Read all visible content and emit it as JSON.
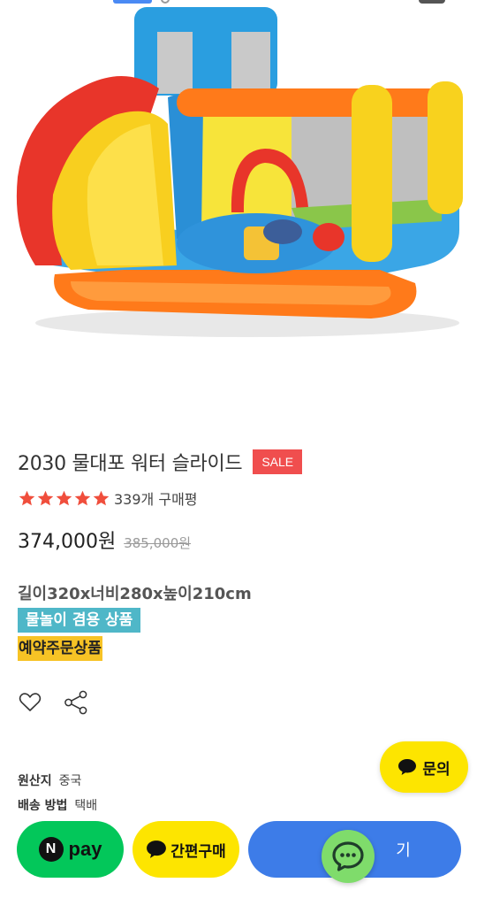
{
  "product": {
    "title": "2030 물대포 워터 슬라이드",
    "sale_badge": "SALE",
    "rating_stars": 5,
    "review_count": "339개 구매평",
    "price": "374,000원",
    "original_price": "385,000원",
    "spec": "길이320x너비280x높이210cm",
    "tags": [
      "물놀이 겸용 상품",
      "예약주문상품"
    ],
    "image_icon": "inflatable-water-slide-image"
  },
  "info": [
    {
      "key": "원산지",
      "value": "중국"
    },
    {
      "key": "배송 방법",
      "value": "택배"
    }
  ],
  "inquiry": {
    "label": "문의"
  },
  "bottom_bar": {
    "npay_n": "N",
    "npay_label": "pay",
    "easy_buy_label": "간편구매",
    "buy_label": "기"
  },
  "colors": {
    "sale_red": "#f04e4e",
    "star_red": "#f04e3c",
    "tag_teal": "#4fb7c8",
    "tag_yellow": "#f7c325",
    "npay_green": "#03c75a",
    "kakao_yellow": "#fde500",
    "buy_blue": "#3d7ce8",
    "chat_green": "#7fdc6b"
  }
}
